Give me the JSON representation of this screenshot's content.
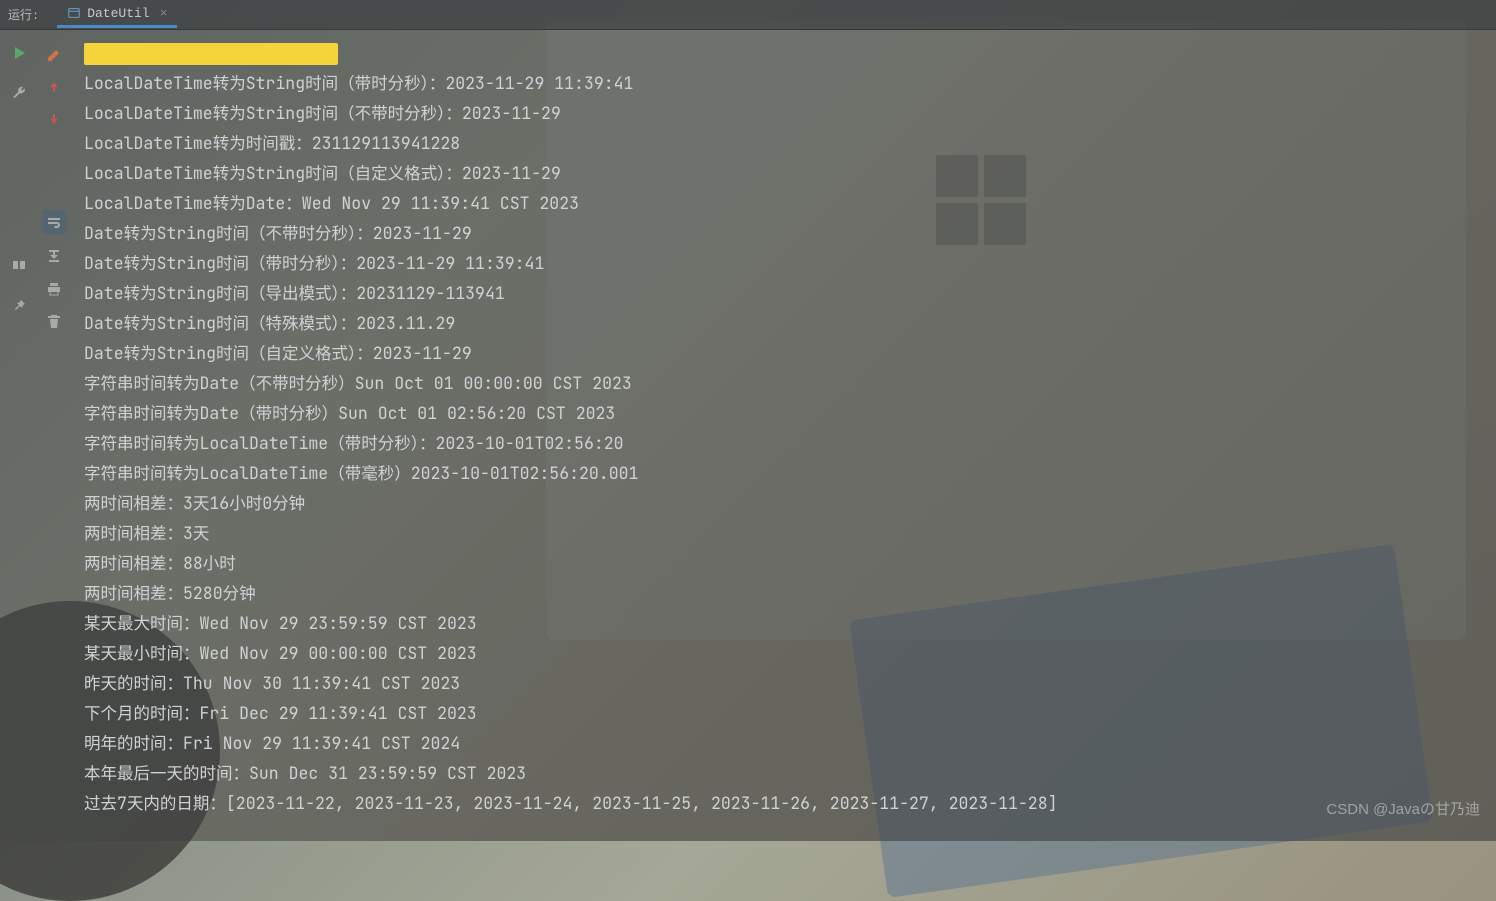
{
  "topbar": {
    "run_label": "运行:",
    "tab_title": "DateUtil"
  },
  "console": {
    "lines": [
      "LocalDateTime转为String时间（带时分秒）：2023-11-29 11:39:41",
      "LocalDateTime转为String时间（不带时分秒）：2023-11-29",
      "LocalDateTime转为时间戳：231129113941228",
      "LocalDateTime转为String时间（自定义格式）：2023-11-29",
      "LocalDateTime转为Date：Wed Nov 29 11:39:41 CST 2023",
      "Date转为String时间（不带时分秒）：2023-11-29",
      "Date转为String时间（带时分秒）：2023-11-29 11:39:41",
      "Date转为String时间（导出模式）：20231129-113941",
      "Date转为String时间（特殊模式）：2023.11.29",
      "Date转为String时间（自定义格式）：2023-11-29",
      "字符串时间转为Date（不带时分秒）Sun Oct 01 00:00:00 CST 2023",
      "字符串时间转为Date（带时分秒）Sun Oct 01 02:56:20 CST 2023",
      "字符串时间转为LocalDateTime（带时分秒）：2023-10-01T02:56:20",
      "字符串时间转为LocalDateTime（带毫秒）2023-10-01T02:56:20.001",
      "两时间相差：3天16小时0分钟",
      "两时间相差：3天",
      "两时间相差：88小时",
      "两时间相差：5280分钟",
      "某天最大时间：Wed Nov 29 23:59:59 CST 2023",
      "某天最小时间：Wed Nov 29 00:00:00 CST 2023",
      "昨天的时间：Thu Nov 30 11:39:41 CST 2023",
      "下个月的时间：Fri Dec 29 11:39:41 CST 2023",
      "明年的时间：Fri Nov 29 11:39:41 CST 2024",
      "本年最后一天的时间：Sun Dec 31 23:59:59 CST 2023",
      "过去7天内的日期：[2023-11-22, 2023-11-23, 2023-11-24, 2023-11-25, 2023-11-26, 2023-11-27, 2023-11-28]"
    ]
  },
  "watermark": "CSDN @Javaの甘乃迪"
}
